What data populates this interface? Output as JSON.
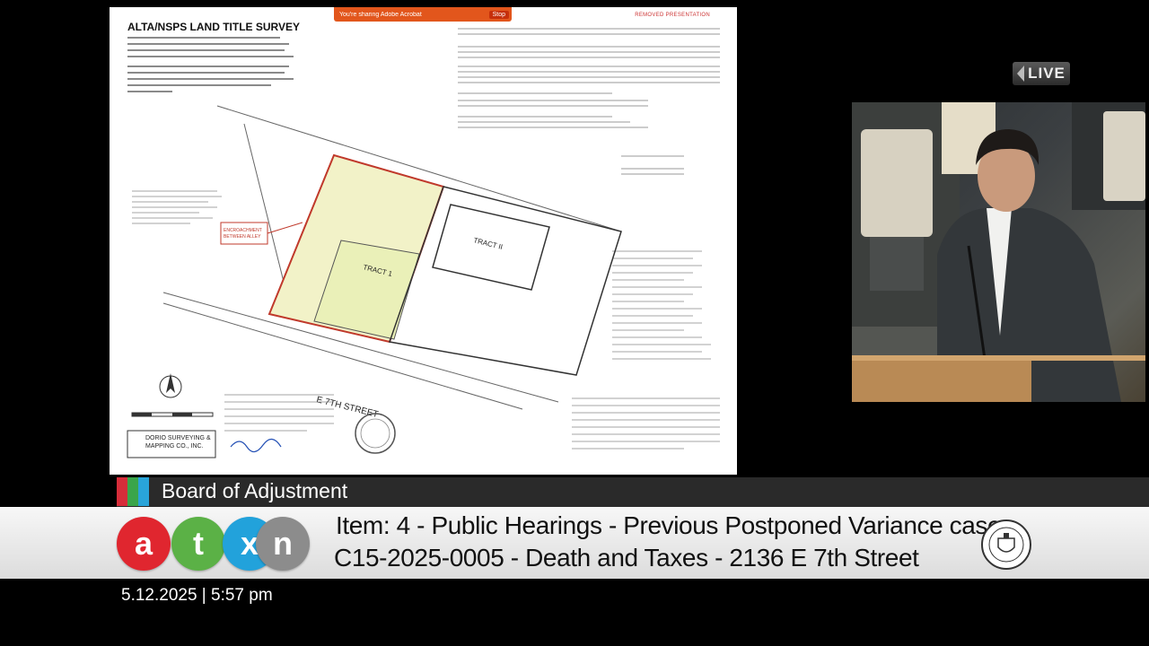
{
  "share_bar": {
    "message": "You're sharing Adobe Acrobat",
    "stop_label": "Stop",
    "color": "#e2561c"
  },
  "document": {
    "title": "ALTA/NSPS LAND TITLE SURVEY",
    "corner_label": "REMOVED PRESENTATION",
    "street_label": "E 7TH STREET",
    "tract1_label": "TRACT 1",
    "tract2_label": "TRACT II",
    "callout_label": "ENCROACHMENT BETWEEN ALLEY AND E 7TH ST.",
    "company_label": "DORIO SURVEYING & MAPPING CO., INC."
  },
  "live_badge": {
    "label": "LIVE"
  },
  "lower_third": {
    "board_title": "Board of Adjustment",
    "accent_colors": [
      "#d62d3a",
      "#3aa54a",
      "#29a4d9"
    ],
    "item_line1": "Item: 4 - Public Hearings - Previous Postponed Variance cases",
    "item_line2": "C15-2025-0005 - Death and Taxes - 2136 E 7th Street",
    "logo_letters": [
      {
        "letter": "a",
        "color": "#e0262f"
      },
      {
        "letter": "t",
        "color": "#5bb146"
      },
      {
        "letter": "x",
        "color": "#22a2db"
      },
      {
        "letter": "n",
        "color": "#8c8c8c"
      }
    ],
    "seal_icon": "city-of-austin-seal-icon"
  },
  "datetime": "5.12.2025 | 5:57 pm"
}
